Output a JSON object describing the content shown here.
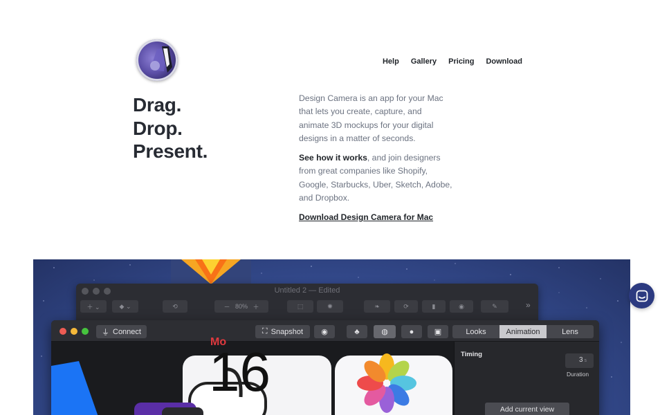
{
  "nav": {
    "links": [
      "Help",
      "Gallery",
      "Pricing",
      "Download"
    ]
  },
  "hero": {
    "title_lines": [
      "Drag.",
      "Drop.",
      "Present."
    ],
    "description": "Design Camera is an app for your Mac that lets you create, capture, and animate 3D mockups for your digital designs in a matter of seconds.",
    "see_how_bold": "See how it works",
    "see_how_rest": ", and join designers from great companies like Shopify, Google, Starbucks, Uber, Sketch, Adobe, and Dropbox.",
    "download_link": "Download Design Camera for Mac"
  },
  "app_back_window": {
    "title": "Untitled 2 — Edited",
    "zoom": "80%",
    "overflow": "»"
  },
  "app_front_window": {
    "connect_label": "Connect",
    "snapshot_label": "Snapshot",
    "tabs": [
      "Looks",
      "Animation",
      "Lens"
    ],
    "selected_tab": "Animation",
    "sidebar": {
      "timing_label": "Timing",
      "duration_value": "3",
      "duration_unit": "s",
      "duration_label": "Duration",
      "add_view_label": "Add current view"
    },
    "preview": {
      "calendar_day": "16",
      "calendar_month": "Mo"
    }
  },
  "icons": [
    "app-logo-icon",
    "chat-icon",
    "sketch-logo-icon",
    "plug-icon",
    "snapshot-icon",
    "camera-icon",
    "apple-icon",
    "photos-icon"
  ],
  "colors": {
    "text_dark": "#272b33",
    "text_muted": "#6b7280",
    "chat_button": "#2c3a80",
    "showcase_bg": "#39529a",
    "app_window": "#1e1f23",
    "traffic_red": "#ee5c54",
    "traffic_yellow": "#f5b83a",
    "traffic_green": "#46c33e"
  }
}
